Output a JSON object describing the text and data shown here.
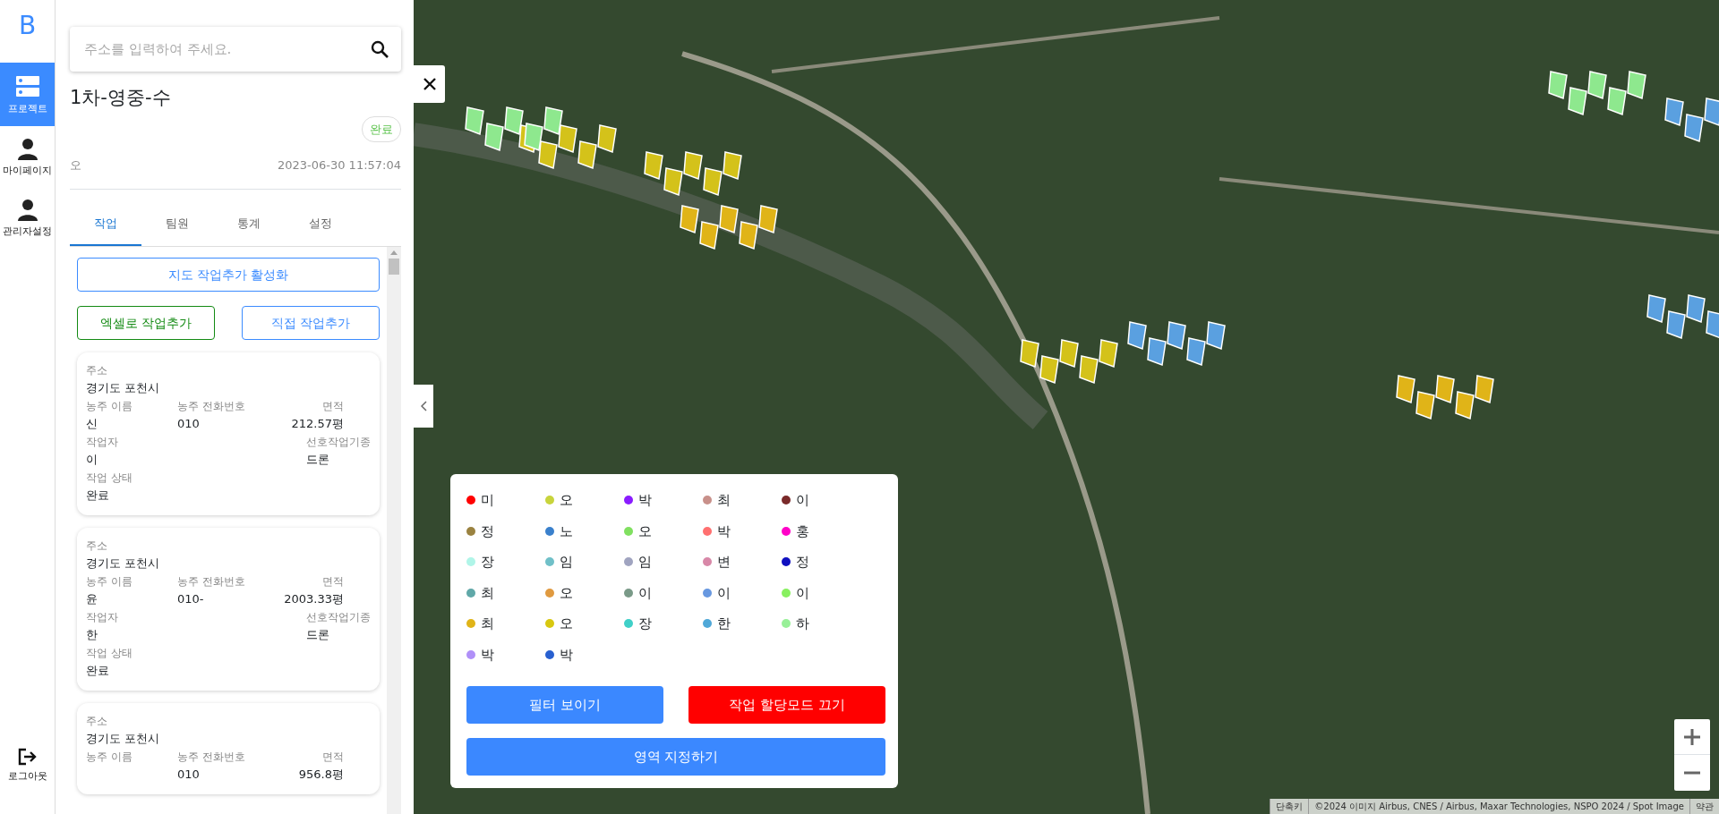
{
  "sidebar": {
    "logo": "B",
    "items": [
      {
        "label": "프로젝트",
        "kind": "server",
        "selected": true
      },
      {
        "label": "마이페이지",
        "kind": "person",
        "selected": false
      },
      {
        "label": "관리자설정",
        "kind": "person",
        "selected": false
      }
    ],
    "logout": "로그아웃"
  },
  "search": {
    "placeholder": "주소를 입력하여 주세요."
  },
  "project": {
    "title": "1차-영중-수",
    "status": "완료",
    "author": "오",
    "date": "2023-06-30 11:57:04"
  },
  "tabs": [
    {
      "label": "작업",
      "selected": true
    },
    {
      "label": "팀원",
      "selected": false
    },
    {
      "label": "통계",
      "selected": false
    },
    {
      "label": "설정",
      "selected": false
    }
  ],
  "actions": {
    "map_add": "지도 작업추가 활성화",
    "excel_add": "엑셀로 작업추가",
    "manual_add": "직접 작업추가"
  },
  "cards": [
    {
      "address_label": "주소",
      "address": "경기도 포천시",
      "owner_label": "농주 이름",
      "phone_label": "농주 전화번호",
      "area_label": "면적",
      "owner": "신",
      "phone": "010",
      "area": "212.57평",
      "worker_label": "작업자",
      "machine_label": "선호작업기종",
      "worker": "이",
      "machine": "드론",
      "status_label": "작업 상태",
      "status": "완료"
    },
    {
      "address_label": "주소",
      "address": "경기도 포천시",
      "owner_label": "농주 이름",
      "phone_label": "농주 전화번호",
      "area_label": "면적",
      "owner": "윤",
      "phone": "010-",
      "area": "2003.33평",
      "worker_label": "작업자",
      "machine_label": "선호작업기종",
      "worker": "한",
      "machine": "드론",
      "status_label": "작업 상태",
      "status": "완료"
    },
    {
      "address_label": "주소",
      "address": "경기도 포천시",
      "owner_label": "농주 이름",
      "phone_label": "농주 전화번호",
      "area_label": "면적",
      "phone": "010",
      "area": "956.8평"
    }
  ],
  "legend": {
    "items": [
      {
        "name": "미",
        "color": "#ff0000"
      },
      {
        "name": "오",
        "color": "#c8d43c"
      },
      {
        "name": "박",
        "color": "#8a1cff"
      },
      {
        "name": "최",
        "color": "#c8908a"
      },
      {
        "name": "이",
        "color": "#7a2a2a"
      },
      {
        "name": "정",
        "color": "#9a8240"
      },
      {
        "name": "노",
        "color": "#3a80cc"
      },
      {
        "name": "오",
        "color": "#80e060"
      },
      {
        "name": "박",
        "color": "#ff7070"
      },
      {
        "name": "홍",
        "color": "#ff00c8"
      },
      {
        "name": "장",
        "color": "#b0f5e8"
      },
      {
        "name": "임",
        "color": "#70c0c8"
      },
      {
        "name": "임",
        "color": "#a0a4c0"
      },
      {
        "name": "변",
        "color": "#d888a8"
      },
      {
        "name": "정",
        "color": "#1010c0"
      },
      {
        "name": "최",
        "color": "#60a8a8"
      },
      {
        "name": "오",
        "color": "#e09a40"
      },
      {
        "name": "이",
        "color": "#7a9a88"
      },
      {
        "name": "이",
        "color": "#6898e0"
      },
      {
        "name": "이",
        "color": "#88f060"
      },
      {
        "name": "최",
        "color": "#e0b418"
      },
      {
        "name": "오",
        "color": "#d8c810"
      },
      {
        "name": "장",
        "color": "#40d0c8"
      },
      {
        "name": "한",
        "color": "#50a8d8"
      },
      {
        "name": "하",
        "color": "#98f098"
      },
      {
        "name": "박",
        "color": "#b090f8"
      },
      {
        "name": "박",
        "color": "#2860d0"
      }
    ],
    "filter_button": "필터 보이기",
    "mode_button": "작업 할당모드 끄기",
    "area_button": "영역 지정하기"
  },
  "attribution": {
    "shortcuts": "단축키",
    "credits": "©2024 이미지 Airbus, CNES / Airbus, Maxar Technologies, NSPO 2024 / Spot Image",
    "terms": "약관"
  }
}
